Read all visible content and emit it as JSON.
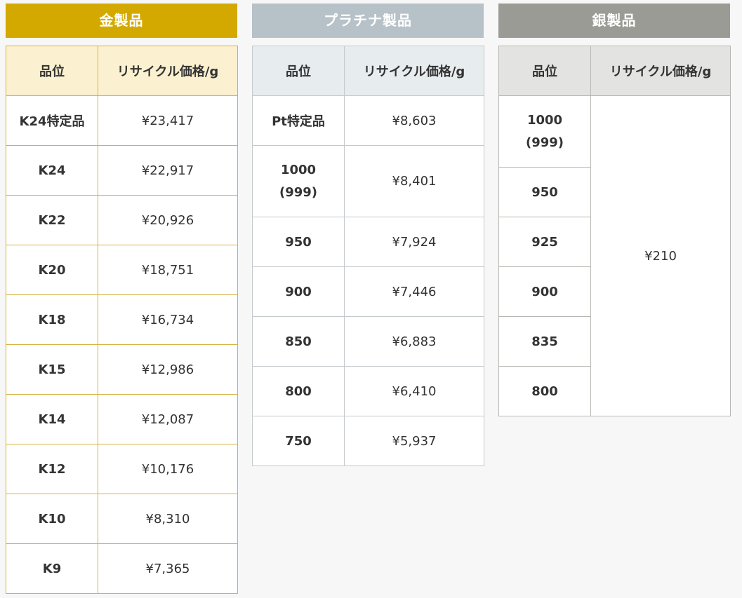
{
  "gold": {
    "title": "金製品",
    "col_grade": "品位",
    "col_price": "リサイクル価格/g",
    "rows": [
      {
        "grade": "K24特定品",
        "price": "¥23,417"
      },
      {
        "grade": "K24",
        "price": "¥22,917"
      },
      {
        "grade": "K22",
        "price": "¥20,926"
      },
      {
        "grade": "K20",
        "price": "¥18,751"
      },
      {
        "grade": "K18",
        "price": "¥16,734"
      },
      {
        "grade": "K15",
        "price": "¥12,986"
      },
      {
        "grade": "K14",
        "price": "¥12,087"
      },
      {
        "grade": "K12",
        "price": "¥10,176"
      },
      {
        "grade": "K10",
        "price": "¥8,310"
      },
      {
        "grade": "K9",
        "price": "¥7,365"
      }
    ]
  },
  "platinum": {
    "title": "プラチナ製品",
    "col_grade": "品位",
    "col_price": "リサイクル価格/g",
    "rows": [
      {
        "grade": "Pt特定品",
        "price": "¥8,603"
      },
      {
        "grade": "1000",
        "grade_sub": "(999)",
        "price": "¥8,401"
      },
      {
        "grade": "950",
        "price": "¥7,924"
      },
      {
        "grade": "900",
        "price": "¥7,446"
      },
      {
        "grade": "850",
        "price": "¥6,883"
      },
      {
        "grade": "800",
        "price": "¥6,410"
      },
      {
        "grade": "750",
        "price": "¥5,937"
      }
    ]
  },
  "silver": {
    "title": "銀製品",
    "col_grade": "品位",
    "col_price": "リサイクル価格/g",
    "shared_price": "¥210",
    "rows": [
      {
        "grade": "1000",
        "grade_sub": "(999)"
      },
      {
        "grade": "950"
      },
      {
        "grade": "925"
      },
      {
        "grade": "900"
      },
      {
        "grade": "835"
      },
      {
        "grade": "800"
      }
    ]
  }
}
